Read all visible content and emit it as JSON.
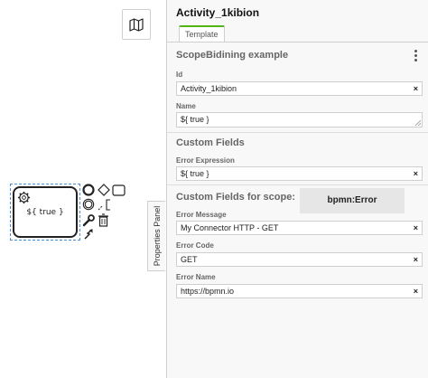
{
  "panel": {
    "title": "Activity_1kibion",
    "tab": "Template",
    "toggle_label": "Properties Panel"
  },
  "canvas": {
    "task_label": "${ true }"
  },
  "template_group": {
    "title": "ScopeBidining example",
    "id_label": "Id",
    "id_value": "Activity_1kibion",
    "name_label": "Name",
    "name_value": "${ true }"
  },
  "custom_fields": {
    "title": "Custom Fields",
    "error_expression_label": "Error Expression",
    "error_expression_value": "${ true }"
  },
  "scope_fields": {
    "title": "Custom Fields for scope:",
    "scope_name": "bpmn:Error",
    "error_message_label": "Error Message",
    "error_message_value": "My Connector HTTP - GET",
    "error_code_label": "Error Code",
    "error_code_value": "GET",
    "error_name_label": "Error Name",
    "error_name_value": "https://bpmn.io"
  },
  "icons": {
    "clear": "×"
  }
}
